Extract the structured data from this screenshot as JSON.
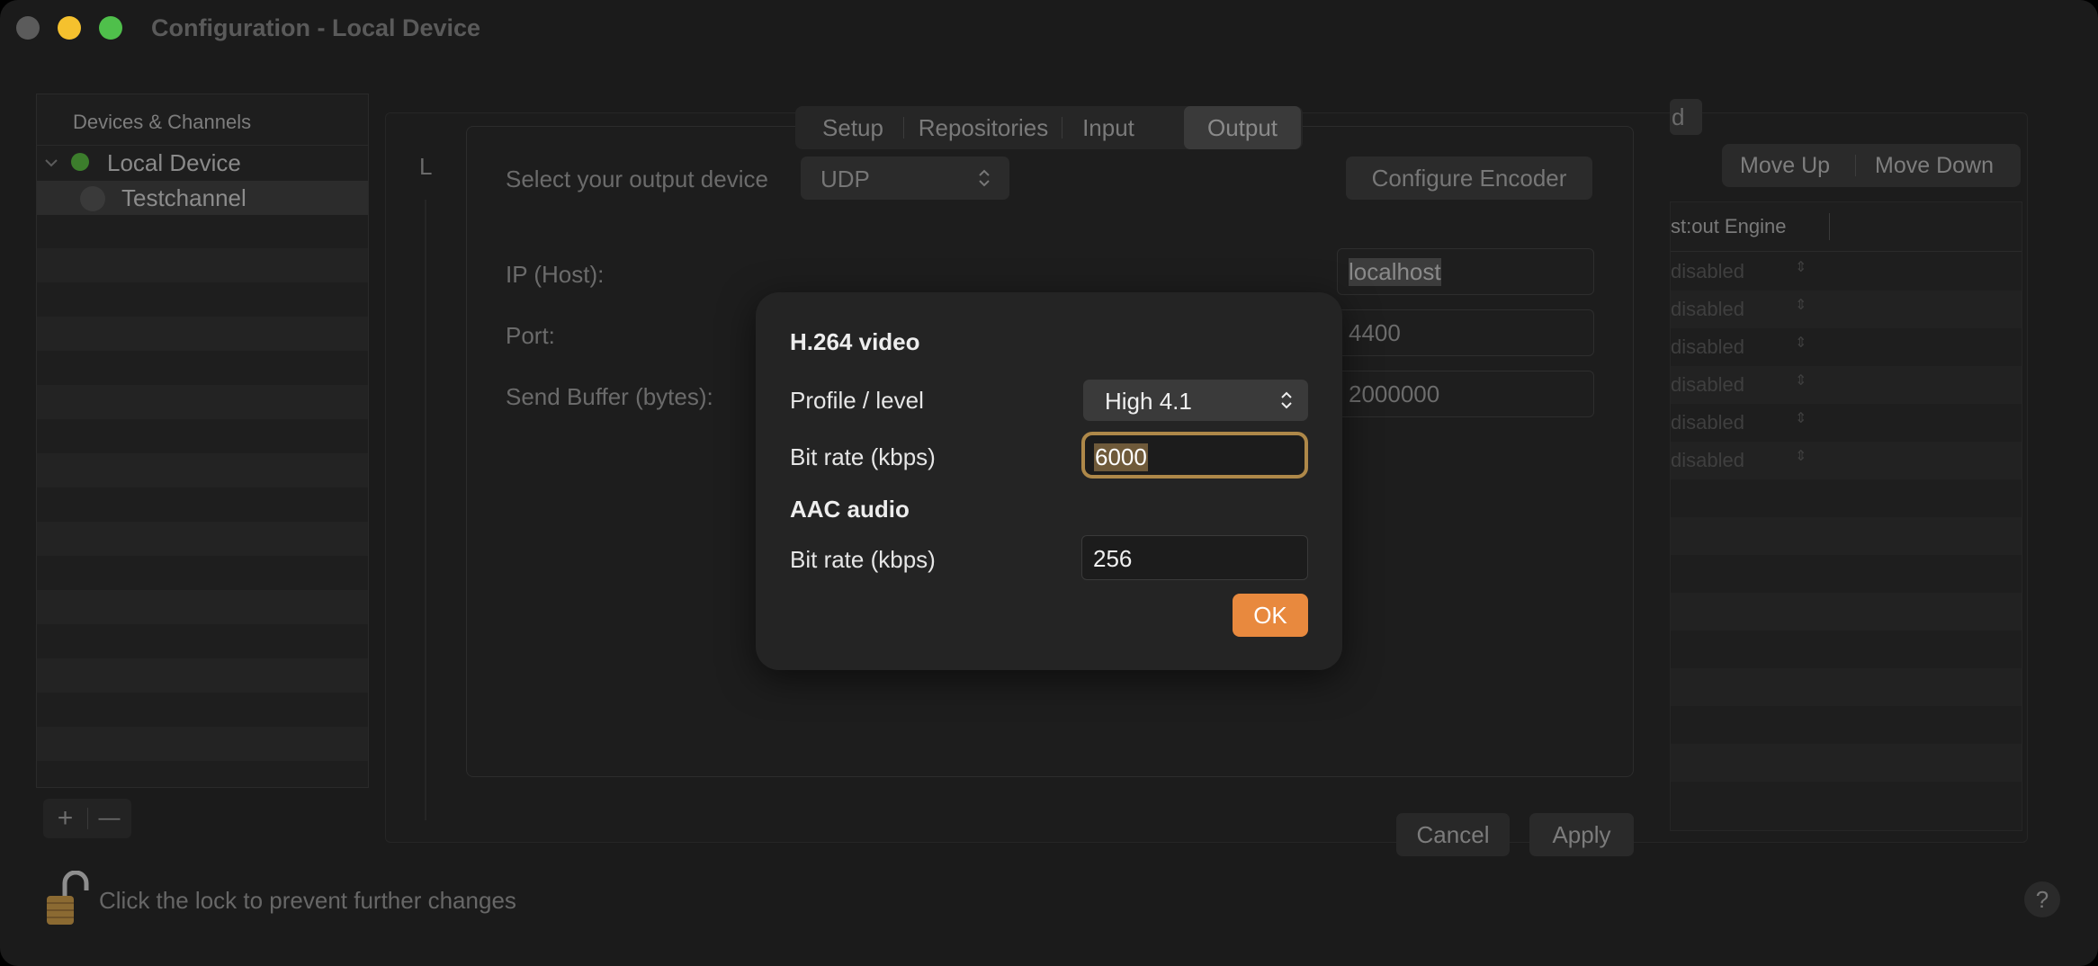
{
  "window": {
    "title": "Configuration - Local Device",
    "traffic_lights": {
      "close": "#5b5b5b",
      "minimize": "#f5c12e",
      "zoom": "#4fc04b"
    }
  },
  "sidebar": {
    "header": "Devices & Channels",
    "device": {
      "label": "Local Device",
      "status_color": "#3c7d2c"
    },
    "channel": {
      "label": "Testchannel"
    },
    "add_label": "+",
    "remove_label": "—"
  },
  "footer": {
    "lock_text": "Click the lock to prevent further changes",
    "help_label": "?"
  },
  "background_panel": {
    "partial_letter": "L",
    "tab_partial": "d",
    "move_up": "Move Up",
    "move_down": "Move Down",
    "column_header": "st:out Engine",
    "rows": [
      "disabled",
      "disabled",
      "disabled",
      "disabled",
      "disabled",
      "disabled"
    ]
  },
  "main_dialog": {
    "tabs": [
      "Setup",
      "Repositories",
      "Input",
      "Output"
    ],
    "active_tab": "Output",
    "output_device_label": "Select your output device",
    "output_device_value": "UDP",
    "configure_encoder": "Configure Encoder",
    "ip_label": "IP (Host):",
    "ip_value": "localhost",
    "port_label": "Port:",
    "port_value": "4400",
    "buffer_label": "Send Buffer (bytes):",
    "buffer_value": "2000000",
    "cancel": "Cancel",
    "apply": "Apply"
  },
  "encoder_sheet": {
    "video_heading": "H.264 video",
    "profile_label": "Profile / level",
    "profile_value": "High 4.1",
    "video_bitrate_label": "Bit rate (kbps)",
    "video_bitrate_value": "6000",
    "audio_heading": "AAC audio",
    "audio_bitrate_label": "Bit rate (kbps)",
    "audio_bitrate_value": "256",
    "ok": "OK",
    "accent_color": "#e8893e"
  }
}
